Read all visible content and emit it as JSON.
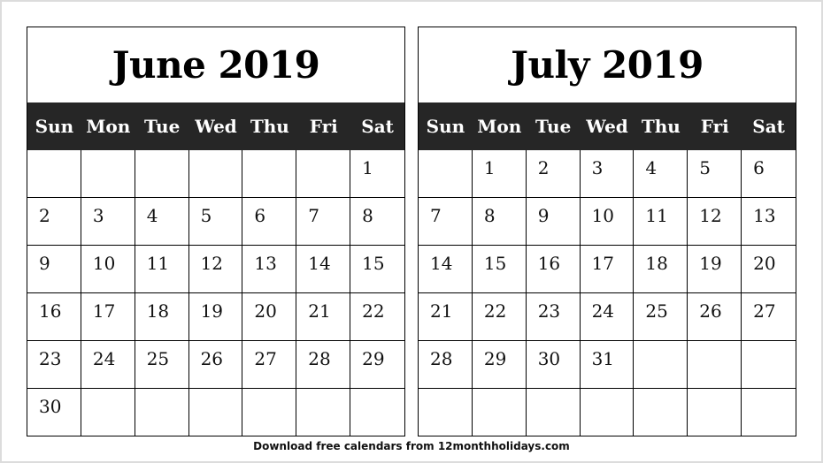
{
  "calendars": [
    {
      "title": "June 2019",
      "weekdays": [
        "Sun",
        "Mon",
        "Tue",
        "Wed",
        "Thu",
        "Fri",
        "Sat"
      ],
      "weeks": [
        [
          "",
          "",
          "",
          "",
          "",
          "",
          "1"
        ],
        [
          "2",
          "3",
          "4",
          "5",
          "6",
          "7",
          "8"
        ],
        [
          "9",
          "10",
          "11",
          "12",
          "13",
          "14",
          "15"
        ],
        [
          "16",
          "17",
          "18",
          "19",
          "20",
          "21",
          "22"
        ],
        [
          "23",
          "24",
          "25",
          "26",
          "27",
          "28",
          "29"
        ],
        [
          "30",
          "",
          "",
          "",
          "",
          "",
          ""
        ]
      ]
    },
    {
      "title": "July 2019",
      "weekdays": [
        "Sun",
        "Mon",
        "Tue",
        "Wed",
        "Thu",
        "Fri",
        "Sat"
      ],
      "weeks": [
        [
          "",
          "1",
          "2",
          "3",
          "4",
          "5",
          "6"
        ],
        [
          "7",
          "8",
          "9",
          "10",
          "11",
          "12",
          "13"
        ],
        [
          "14",
          "15",
          "16",
          "17",
          "18",
          "19",
          "20"
        ],
        [
          "21",
          "22",
          "23",
          "24",
          "25",
          "26",
          "27"
        ],
        [
          "28",
          "29",
          "30",
          "31",
          "",
          "",
          ""
        ],
        [
          "",
          "",
          "",
          "",
          "",
          "",
          ""
        ]
      ]
    }
  ],
  "footer": "Download free calendars from 12monthholidays.com",
  "colors": {
    "header_bar": "#262626",
    "header_text": "#ffffff",
    "grid_line": "#000000",
    "frame": "#dcdcdc"
  }
}
